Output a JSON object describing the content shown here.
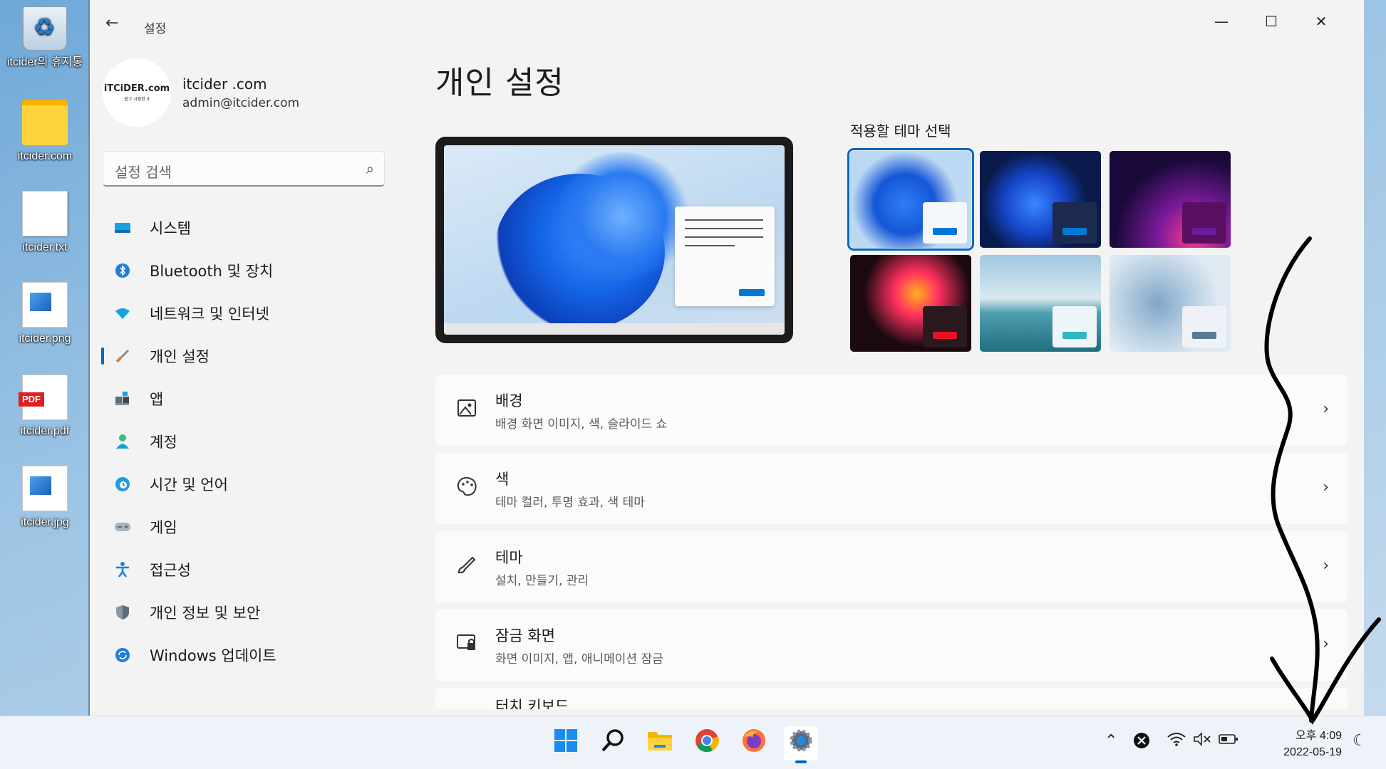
{
  "desktop": {
    "icons": [
      {
        "label": "itcider의 휴지통",
        "icon": "recycle-bin-icon"
      },
      {
        "label": "itcider.com",
        "icon": "folder-icon"
      },
      {
        "label": "itcider.txt",
        "icon": "text-file-icon"
      },
      {
        "label": "itcider.png",
        "icon": "image-file-icon"
      },
      {
        "label": "itcider.pdf",
        "icon": "pdf-file-icon"
      },
      {
        "label": "itcider.jpg",
        "icon": "image-file-icon"
      }
    ],
    "pdf_badge": "PDF"
  },
  "window": {
    "title": "설정",
    "controls": {
      "minimize": "—",
      "maximize": "☐",
      "close": "✕"
    }
  },
  "profile": {
    "avatar_text": "iTCiDER.com",
    "avatar_sub": "쉽고 시원한 it",
    "name": "itcider .com",
    "email": "admin@itcider.com"
  },
  "search": {
    "placeholder": "설정 검색"
  },
  "nav": [
    {
      "label": "시스템",
      "icon": "monitor-icon"
    },
    {
      "label": "Bluetooth 및 장치",
      "icon": "bluetooth-icon"
    },
    {
      "label": "네트워크 및 인터넷",
      "icon": "wifi-icon"
    },
    {
      "label": "개인 설정",
      "icon": "brush-icon",
      "active": true
    },
    {
      "label": "앱",
      "icon": "apps-icon"
    },
    {
      "label": "계정",
      "icon": "person-icon"
    },
    {
      "label": "시간 및 언어",
      "icon": "clock-globe-icon"
    },
    {
      "label": "게임",
      "icon": "gamepad-icon"
    },
    {
      "label": "접근성",
      "icon": "accessibility-icon"
    },
    {
      "label": "개인 정보 및 보안",
      "icon": "shield-icon"
    },
    {
      "label": "Windows 업데이트",
      "icon": "update-icon"
    }
  ],
  "main": {
    "title": "개인 설정",
    "themes_heading": "적용할 테마 선택",
    "themes": [
      {
        "name": "windows-light",
        "selected": true,
        "accent": "#0078d4"
      },
      {
        "name": "windows-dark",
        "selected": false,
        "accent": "#0078d4"
      },
      {
        "name": "glow",
        "selected": false,
        "accent": "#6a1b9a"
      },
      {
        "name": "captured-motion",
        "selected": false,
        "accent": "#e81123"
      },
      {
        "name": "sunrise",
        "selected": false,
        "accent": "#2fb8c2"
      },
      {
        "name": "flow",
        "selected": false,
        "accent": "#5a7a93"
      }
    ],
    "settings": [
      {
        "title": "배경",
        "desc": "배경 화면 이미지, 색, 슬라이드 쇼",
        "icon": "image-icon"
      },
      {
        "title": "색",
        "desc": "테마 컬러, 투명 효과, 색 테마",
        "icon": "palette-icon"
      },
      {
        "title": "테마",
        "desc": "설치, 만들기, 관리",
        "icon": "brush-icon"
      },
      {
        "title": "잠금 화면",
        "desc": "화면 이미지, 앱, 애니메이션 잠금",
        "icon": "lock-screen-icon"
      }
    ],
    "partial_row_title": "터치 키보드"
  },
  "taskbar": {
    "apps": [
      {
        "name": "start-icon"
      },
      {
        "name": "search-icon"
      },
      {
        "name": "file-explorer-icon"
      },
      {
        "name": "chrome-icon"
      },
      {
        "name": "firefox-icon"
      },
      {
        "name": "settings-gear-icon",
        "active": true
      }
    ],
    "time": "오후 4:09",
    "date": "2022-05-19"
  },
  "colors": {
    "accent": "#0067c0",
    "window_bg": "#f3f3f3"
  }
}
